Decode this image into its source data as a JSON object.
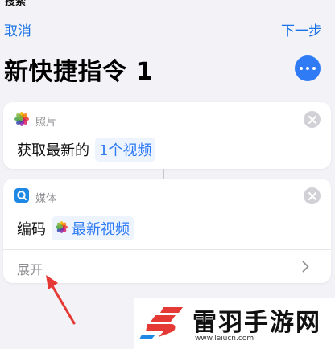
{
  "status": {
    "partial_label": "搜索"
  },
  "nav": {
    "cancel_label": "取消",
    "next_label": "下一步"
  },
  "title": "新快捷指令 1",
  "actions": [
    {
      "app_name": "照片",
      "icon": "photos-icon",
      "verb": "获取最新的",
      "token": "1个视频"
    },
    {
      "app_name": "媒体",
      "icon": "media-icon",
      "verb": "编码",
      "token": "最新视频",
      "token_icon": "photos-icon",
      "expand_label": "展开"
    }
  ],
  "colors": {
    "accent": "#2f7bf6",
    "nav_link": "#1a73e8",
    "background": "#f2f2f7",
    "arrow": "#e53935"
  },
  "watermark": {
    "brand": "雷羽手游网",
    "url": "www.leiucn.com"
  }
}
